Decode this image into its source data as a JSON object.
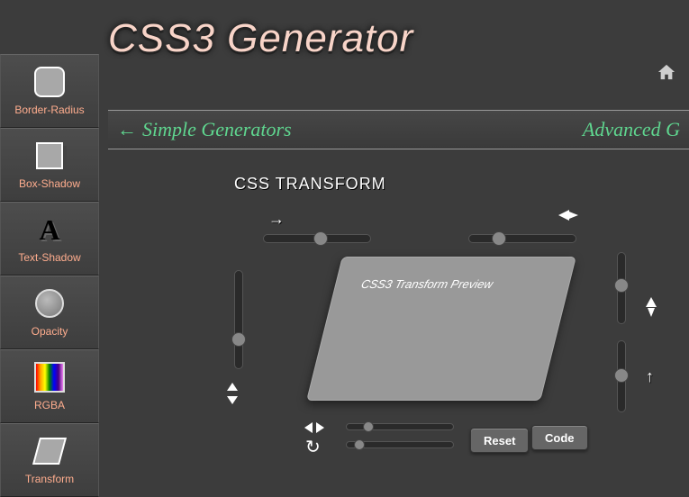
{
  "header": {
    "title": "CSS3 Generator"
  },
  "crumb": {
    "left": "Simple Generators",
    "right": "Advanced G"
  },
  "sidebar": {
    "items": [
      {
        "label": "Border-Radius"
      },
      {
        "label": "Box-Shadow"
      },
      {
        "label": "Text-Shadow"
      },
      {
        "label": "Opacity"
      },
      {
        "label": "RGBA"
      },
      {
        "label": "Transform"
      }
    ]
  },
  "main": {
    "section_title": "CSS TRANSFORM",
    "preview_text": "CSS3 Transform Preview",
    "buttons": {
      "reset": "Reset",
      "code": "Code"
    }
  }
}
